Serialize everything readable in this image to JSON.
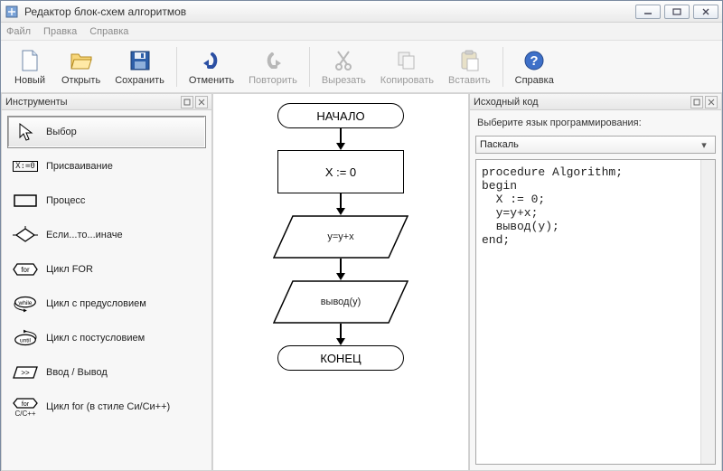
{
  "window": {
    "title": "Редактор блок-схем алгоритмов"
  },
  "menu": {
    "file": "Файл",
    "edit": "Правка",
    "help": "Справка"
  },
  "toolbar": {
    "new": "Новый",
    "open": "Открыть",
    "save": "Сохранить",
    "undo": "Отменить",
    "redo": "Повторить",
    "cut": "Вырезать",
    "copy": "Копировать",
    "paste": "Вставить",
    "help": "Справка"
  },
  "panes": {
    "tools_title": "Инструменты",
    "source_title": "Исходный код",
    "lang_prompt": "Выберите язык программирования:",
    "lang_selected": "Паскаль"
  },
  "tools": {
    "select": "Выбор",
    "assign": "Присваивание",
    "process": "Процесс",
    "ifelse": "Если...то...иначе",
    "for": "Цикл FOR",
    "while": "Цикл с предусловием",
    "until": "Цикл с постусловием",
    "io": "Ввод / Вывод",
    "cfor": "Цикл for (в стиле Си/Си++)",
    "assign_icon_text": "X:=0",
    "for_icon_text": "for",
    "while_icon_text": "while",
    "until_icon_text": "until",
    "io_icon_text": ">>",
    "cfor_icon_text": "for",
    "cfor_sub": "C/C++"
  },
  "flow": {
    "start": "НАЧАЛО",
    "n1": "X := 0",
    "n2": "y=y+x",
    "n3": "вывод(y)",
    "end": "КОНЕЦ"
  },
  "code": "procedure Algorithm;\nbegin\n  X := 0;\n  y=y+x;\n  вывод(y);\nend;"
}
